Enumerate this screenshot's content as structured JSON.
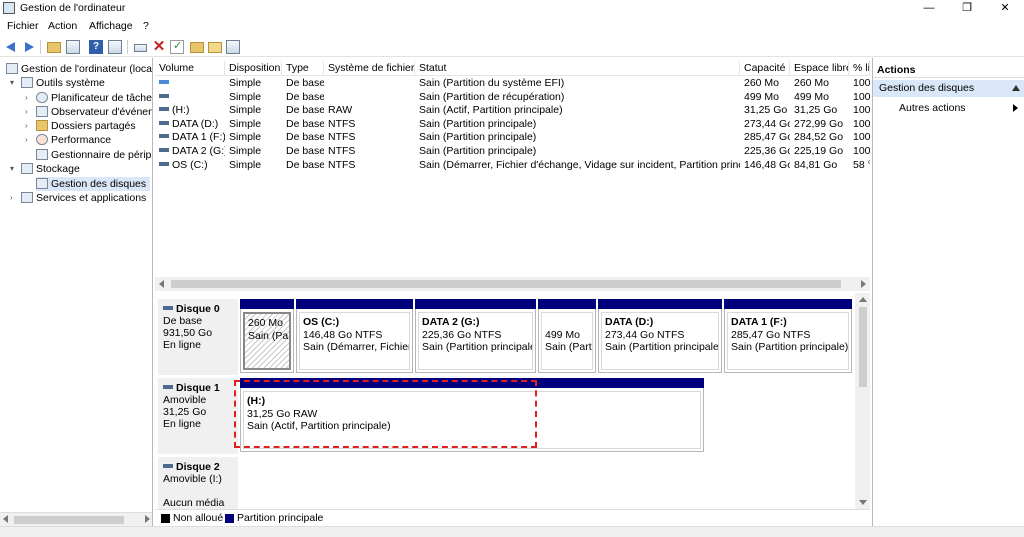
{
  "window": {
    "title": "Gestion de l'ordinateur",
    "minimize": "—",
    "maximize": "❐",
    "close": "✕"
  },
  "menu": [
    "Fichier",
    "Action",
    "Affichage",
    "?"
  ],
  "tree": {
    "root": "Gestion de l'ordinateur (local)",
    "outils": "Outils système",
    "planif": "Planificateur de tâches",
    "observ": "Observateur d'événeme",
    "dossiers": "Dossiers partagés",
    "perf": "Performance",
    "periph": "Gestionnaire de périphé",
    "stockage": "Stockage",
    "gestion": "Gestion des disques",
    "services": "Services et applications"
  },
  "volumes": {
    "headers": [
      "Volume",
      "Disposition",
      "Type",
      "Système de fichiers",
      "Statut",
      "Capacité",
      "Espace libre",
      "% li"
    ],
    "rows": [
      [
        "",
        "Simple",
        "De base",
        "",
        "Sain (Partition du système EFI)",
        "260 Mo",
        "260 Mo",
        "100"
      ],
      [
        "",
        "Simple",
        "De base",
        "",
        "Sain (Partition de récupération)",
        "499 Mo",
        "499 Mo",
        "100"
      ],
      [
        "(H:)",
        "Simple",
        "De base",
        "RAW",
        "Sain (Actif, Partition principale)",
        "31,25 Go",
        "31,25 Go",
        "100"
      ],
      [
        "DATA (D:)",
        "Simple",
        "De base",
        "NTFS",
        "Sain (Partition principale)",
        "273,44 Go",
        "272,99 Go",
        "100"
      ],
      [
        "DATA 1 (F:)",
        "Simple",
        "De base",
        "NTFS",
        "Sain (Partition principale)",
        "285,47 Go",
        "284,52 Go",
        "100"
      ],
      [
        "DATA 2 (G:)",
        "Simple",
        "De base",
        "NTFS",
        "Sain (Partition principale)",
        "225,36 Go",
        "225,19 Go",
        "100"
      ],
      [
        "OS (C:)",
        "Simple",
        "De base",
        "NTFS",
        "Sain (Démarrer, Fichier d'échange, Vidage sur incident, Partition principale)",
        "146,48 Go",
        "84,81 Go",
        "58 °"
      ]
    ]
  },
  "disk0": {
    "name": "Disque 0",
    "type": "De base",
    "size": "931,50 Go",
    "status": "En ligne",
    "p1": {
      "size": "260 Mo",
      "status": "Sain (Parti"
    },
    "p2": {
      "name": "OS  (C:)",
      "size": "146,48 Go NTFS",
      "status": "Sain (Démarrer, Fichier d'"
    },
    "p3": {
      "name": "DATA 2  (G:)",
      "size": "225,36 Go NTFS",
      "status": "Sain (Partition principale)"
    },
    "p4": {
      "size": "499 Mo",
      "status": "Sain (Partiti"
    },
    "p5": {
      "name": "DATA  (D:)",
      "size": "273,44 Go NTFS",
      "status": "Sain (Partition principale)"
    },
    "p6": {
      "name": "DATA 1  (F:)",
      "size": "285,47 Go NTFS",
      "status": "Sain (Partition principale)"
    }
  },
  "disk1": {
    "name": "Disque 1",
    "type": "Amovible",
    "size": "31,25 Go",
    "status": "En ligne",
    "p1": {
      "name": "(H:)",
      "size": "31,25 Go RAW",
      "status": "Sain (Actif, Partition principale)"
    }
  },
  "disk2": {
    "name": "Disque 2",
    "type": "Amovible (I:)",
    "status": "Aucun média"
  },
  "legend": {
    "unalloc": "Non alloué",
    "primary": "Partition principale",
    "unalloc_color": "#000000",
    "primary_color": "#00007f"
  },
  "actions": {
    "header": "Actions",
    "section": "Gestion des disques",
    "item": "Autres actions"
  }
}
